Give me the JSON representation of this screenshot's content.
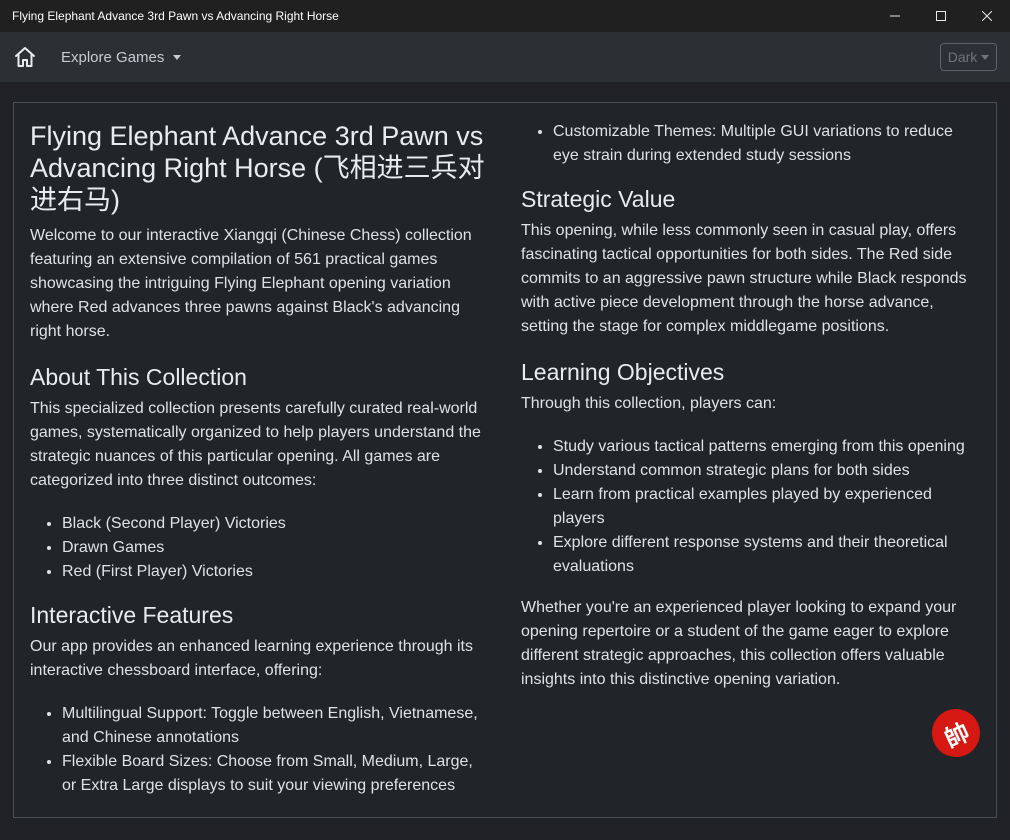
{
  "window": {
    "title": "Flying Elephant Advance 3rd Pawn vs Advancing Right Horse"
  },
  "navbar": {
    "explore_label": "Explore Games",
    "theme_label": "Dark"
  },
  "left": {
    "title": "Flying Elephant Advance 3rd Pawn vs Advancing Right Horse (飞相进三兵对进右马)",
    "intro": "Welcome to our interactive Xiangqi (Chinese Chess) collection featuring an extensive compilation of 561 practical games showcasing the intriguing Flying Elephant opening variation where Red advances three pawns against Black's advancing right horse.",
    "about_heading": "About This Collection",
    "about_text": "This specialized collection presents carefully curated real-world games, systematically organized to help players understand the strategic nuances of this particular opening. All games are categorized into three distinct outcomes:",
    "outcomes": [
      "Black (Second Player) Victories",
      "Drawn Games",
      "Red (First Player) Victories"
    ],
    "features_heading": "Interactive Features",
    "features_text": "Our app provides an enhanced learning experience through its interactive chessboard interface, offering:",
    "features": [
      "Multilingual Support: Toggle between English, Vietnamese, and Chinese annotations",
      "Flexible Board Sizes: Choose from Small, Medium, Large, or Extra Large displays to suit your viewing preferences"
    ]
  },
  "right": {
    "features_cont": [
      "Customizable Themes: Multiple GUI variations to reduce eye strain during extended study sessions"
    ],
    "strategic_heading": "Strategic Value",
    "strategic_text": "This opening, while less commonly seen in casual play, offers fascinating tactical opportunities for both sides. The Red side commits to an aggressive pawn structure while Black responds with active piece development through the horse advance, setting the stage for complex middlegame positions.",
    "learning_heading": "Learning Objectives",
    "learning_text": "Through this collection, players can:",
    "objectives": [
      "Study various tactical patterns emerging from this opening",
      "Understand common strategic plans for both sides",
      "Learn from practical examples played by experienced players",
      "Explore different response systems and their theoretical evaluations"
    ],
    "closing": "Whether you're an experienced player looking to expand your opening repertoire or a student of the game eager to explore different strategic approaches, this collection offers valuable insights into this distinctive opening variation."
  },
  "logo": {
    "glyph": "帥",
    "color": "#d51812"
  },
  "icons": {
    "home": "home-icon",
    "minimize": "minimize-icon",
    "maximize": "maximize-icon",
    "close": "close-icon"
  }
}
